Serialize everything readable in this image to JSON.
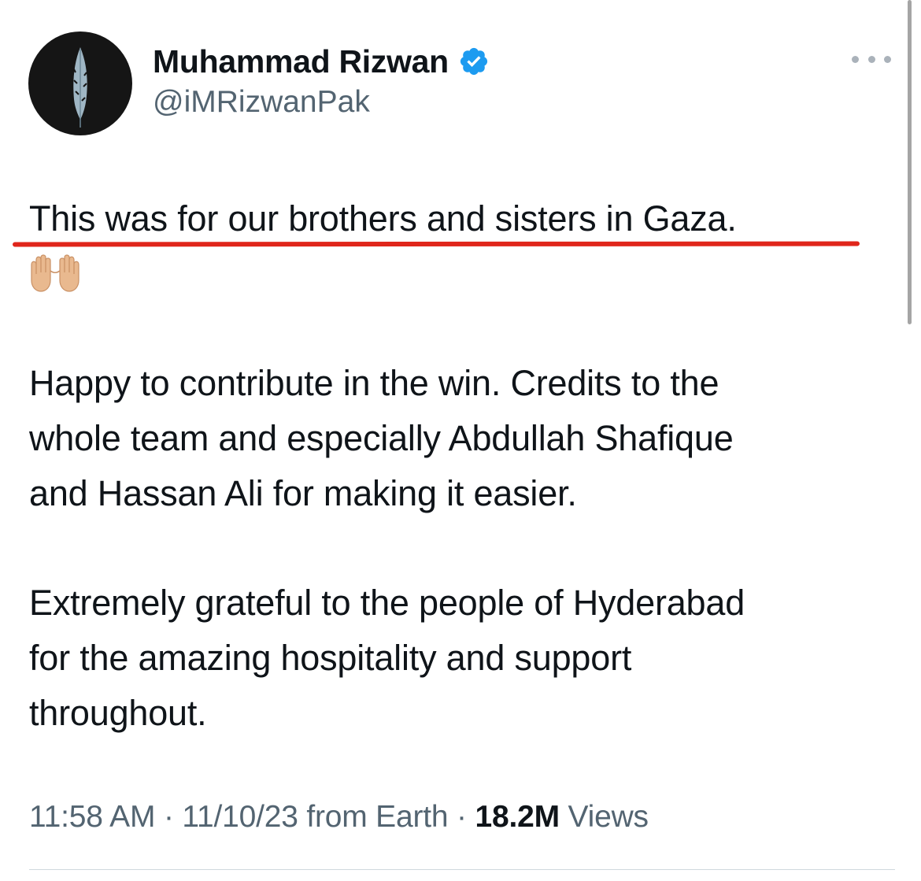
{
  "header": {
    "display_name": "Muhammad Rizwan",
    "handle": "@iMRizwanPak",
    "verified_icon": "verified-badge-icon",
    "verified_color": "#1d9bf0",
    "more_icon": "more-options-icon"
  },
  "tweet": {
    "line1": "This was for our brothers and sisters in Gaza.",
    "emoji_icon": "palms-up-together-icon",
    "para2_line1": "Happy to contribute in the win. Credits to the",
    "para2_line2": "whole team and especially Abdullah Shafique",
    "para2_line3": "and Hassan Ali for making it easier.",
    "para3_line1": "Extremely grateful to the people of Hyderabad",
    "para3_line2": "for the amazing hospitality and support",
    "para3_line3": "throughout."
  },
  "annotation": {
    "underline_color": "#e0261b"
  },
  "meta": {
    "time": "11:58 AM",
    "separator": "·",
    "date": "11/10/23",
    "source": "from Earth",
    "views_count": "18.2M",
    "views_label": "Views"
  }
}
